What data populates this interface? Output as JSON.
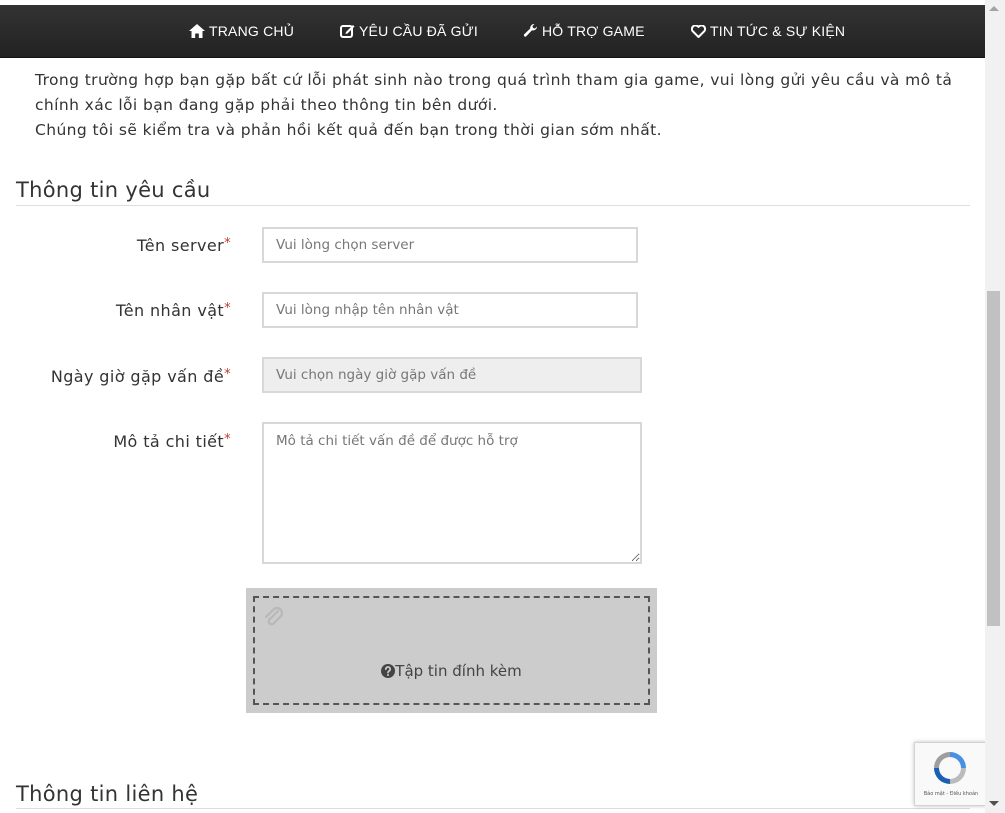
{
  "nav": {
    "items": [
      {
        "label": "TRANG CHỦ",
        "icon": "home-icon"
      },
      {
        "label": "YÊU CẦU ĐÃ GỬI",
        "icon": "edit-icon"
      },
      {
        "label": "HỖ TRỢ GAME",
        "icon": "wrench-icon"
      },
      {
        "label": "TIN TỨC & SỰ KIỆN",
        "icon": "heart-icon"
      }
    ]
  },
  "intro": {
    "line1": "Trong trường hợp bạn gặp bất cứ lỗi phát sinh nào trong quá trình tham gia game, vui lòng gửi yêu cầu và mô tả chính xác lỗi bạn đang gặp phải theo thông tin bên dưới.",
    "line2": "Chúng tôi sẽ kiểm tra và phản hồi kết quả đến bạn trong thời gian sớm nhất."
  },
  "request_section": {
    "title": "Thông tin yêu cầu",
    "required_mark": "*",
    "fields": [
      {
        "label": "Tên server",
        "placeholder": "Vui lòng chọn server"
      },
      {
        "label": "Tên nhân vật",
        "placeholder": "Vui lòng nhập tên nhân vật"
      },
      {
        "label": "Ngày giờ gặp vấn đề",
        "placeholder": "Vui chọn ngày giờ gặp vấn đề"
      },
      {
        "label": "Mô tả chi tiết",
        "placeholder": "Mô tả chi tiết vấn đề để được hỗ trợ"
      }
    ],
    "attachment": {
      "label": "Tập tin đính kèm",
      "icon": "paperclip-icon"
    }
  },
  "contact_section": {
    "title": "Thông tin liên hệ"
  },
  "recaptcha": {
    "terms": "Bảo mật - Điều khoản"
  },
  "colors": {
    "navbar": "#2a2a2a",
    "required": "#c0392b",
    "dropzone": "#cccccc"
  }
}
